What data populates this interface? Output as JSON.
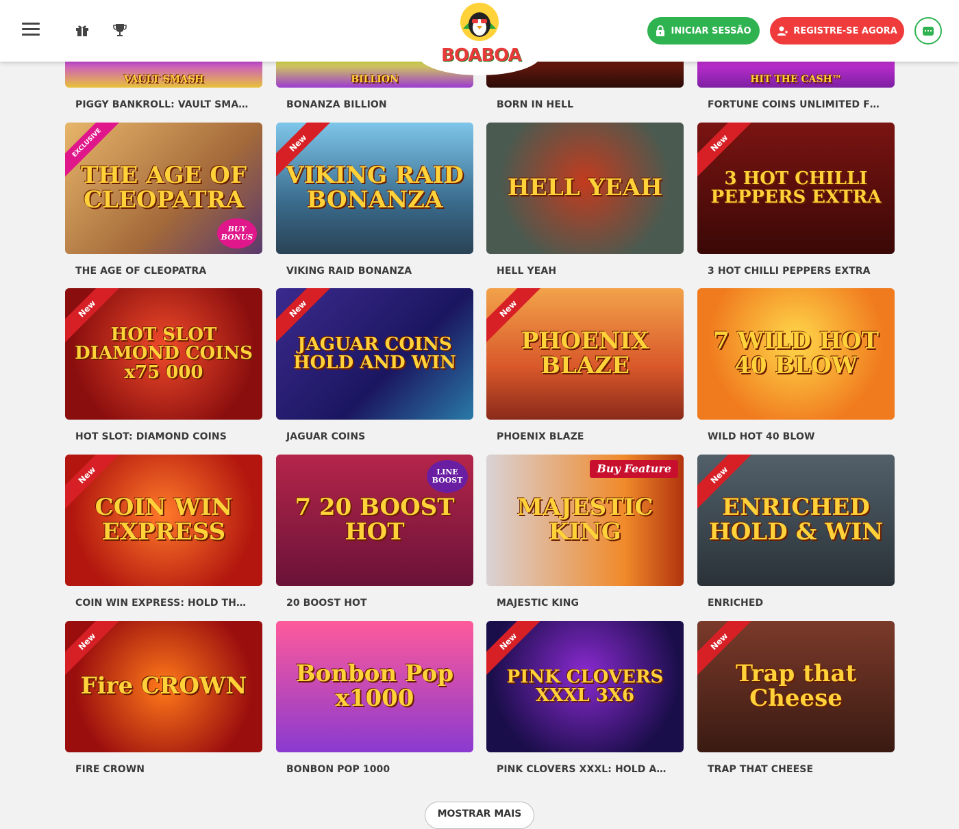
{
  "header": {
    "login_label": "INICIAR SESSÃO",
    "register_label": "REGISTRE-SE AGORA",
    "logo_text": "BOABOA",
    "colors": {
      "login": "#2fb351",
      "register": "#ef3b3b"
    }
  },
  "partial_row": [
    {
      "caption": "PIGGY BANKROLL: VAULT SMASH",
      "art": "VAULT SMASH",
      "bg": "linear-gradient(180deg,#c74bd6,#e8c23a)"
    },
    {
      "caption": "BONANZA BILLION",
      "art": "BILLION",
      "bg": "linear-gradient(180deg,#d9e04a,#9c3bd0)"
    },
    {
      "caption": "BORN IN HELL",
      "art": "",
      "bg": "linear-gradient(180deg,#6b1a0e,#2a0b06)"
    },
    {
      "caption": "FORTUNE COINS UNLIMITED FOR...",
      "art": "HIT THE CASH™",
      "bg": "linear-gradient(180deg,#c12fd1,#7d1fa3)"
    }
  ],
  "games": [
    {
      "caption": "THE AGE OF CLEOPATRA",
      "art": "THE AGE OF CLEOPATRA",
      "ribbon": "EXCLUSIVE",
      "badge": "BUY BONUS",
      "bg": "linear-gradient(135deg,#e7b56a,#a46a3a 60%,#5a3a6e)"
    },
    {
      "caption": "VIKING RAID BONANZA",
      "art": "VIKING RAID BONANZA",
      "ribbon": "New",
      "badge": "",
      "bg": "linear-gradient(180deg,#7ec6ea,#3a6c8d 60%,#2a4255)"
    },
    {
      "caption": "HELL YEAH",
      "art": "HELL YEAH",
      "ribbon": "",
      "badge": "",
      "bg": "radial-gradient(circle at 50% 45%,#c33b1e,#4a5a50 70%)"
    },
    {
      "caption": "3 HOT CHILLI PEPPERS EXTRA",
      "art": "3 HOT CHILLI PEPPERS EXTRA",
      "ribbon": "New",
      "badge": "",
      "bg": "linear-gradient(180deg,#7a1412,#3a0806)"
    },
    {
      "caption": "HOT SLOT: DIAMOND COINS",
      "art": "HOT SLOT DIAMOND COINS x75 000",
      "ribbon": "New",
      "badge": "",
      "bg": "radial-gradient(circle at 50% 45%,#ef4b2a,#8a0e0e 75%)"
    },
    {
      "caption": "JAGUAR COINS",
      "art": "JAGUAR COINS HOLD AND WIN",
      "ribbon": "New",
      "badge": "",
      "bg": "linear-gradient(135deg,#3b2a8e,#1b1660 60%,#2a7aa8)"
    },
    {
      "caption": "PHOENIX BLAZE",
      "art": "PHOENIX BLAZE",
      "ribbon": "New",
      "badge": "",
      "bg": "linear-gradient(180deg,#f2a24a,#d9582a 60%,#8a2a1a)"
    },
    {
      "caption": "WILD HOT 40 BLOW",
      "art": "7 WILD HOT 40 BLOW",
      "ribbon": "",
      "badge": "",
      "bg": "radial-gradient(circle at 50% 40%,#ffd84a,#f07a1e 70%)"
    },
    {
      "caption": "COIN WIN EXPRESS: HOLD THE S...",
      "art": "COIN WIN EXPRESS",
      "ribbon": "New",
      "badge": "",
      "bg": "radial-gradient(circle at 50% 45%,#ff7a2a,#b2160e 75%)"
    },
    {
      "caption": "20 BOOST HOT",
      "art": "7 20 BOOST HOT",
      "ribbon": "",
      "badge": "LINE BOOST",
      "bg": "linear-gradient(180deg,#b5254a,#6a1238)"
    },
    {
      "caption": "MAJESTIC KING",
      "art": "MAJESTIC KING",
      "ribbon": "",
      "badge": "Buy Feature",
      "bg": "linear-gradient(90deg,#d9d2d6,#f08a2a 70%,#b2330e)"
    },
    {
      "caption": "ENRICHED",
      "art": "ENRICHED HOLD & WIN",
      "ribbon": "New",
      "badge": "",
      "bg": "linear-gradient(180deg,#52606a,#2a3238)"
    },
    {
      "caption": "FIRE CROWN",
      "art": "Fire CROWN",
      "ribbon": "New",
      "badge": "",
      "bg": "radial-gradient(circle at 50% 50%,#ff7a1a,#9a0e0e 75%)"
    },
    {
      "caption": "BONBON POP 1000",
      "art": "Bonbon Pop x1000",
      "ribbon": "",
      "badge": "",
      "bg": "linear-gradient(180deg,#ff5a9a,#8a3ad0)"
    },
    {
      "caption": "PINK CLOVERS XXXL: HOLD AND ...",
      "art": "PINK CLOVERS XXXL 3X6",
      "ribbon": "New",
      "badge": "",
      "bg": "radial-gradient(circle at 50% 40%,#8a2ad0,#1a0e4a 75%)"
    },
    {
      "caption": "TRAP THAT CHEESE",
      "art": "Trap that Cheese",
      "ribbon": "New",
      "badge": "",
      "bg": "linear-gradient(180deg,#7a3a2a,#3a1a12)"
    }
  ],
  "show_more_label": "MOSTRAR MAIS"
}
